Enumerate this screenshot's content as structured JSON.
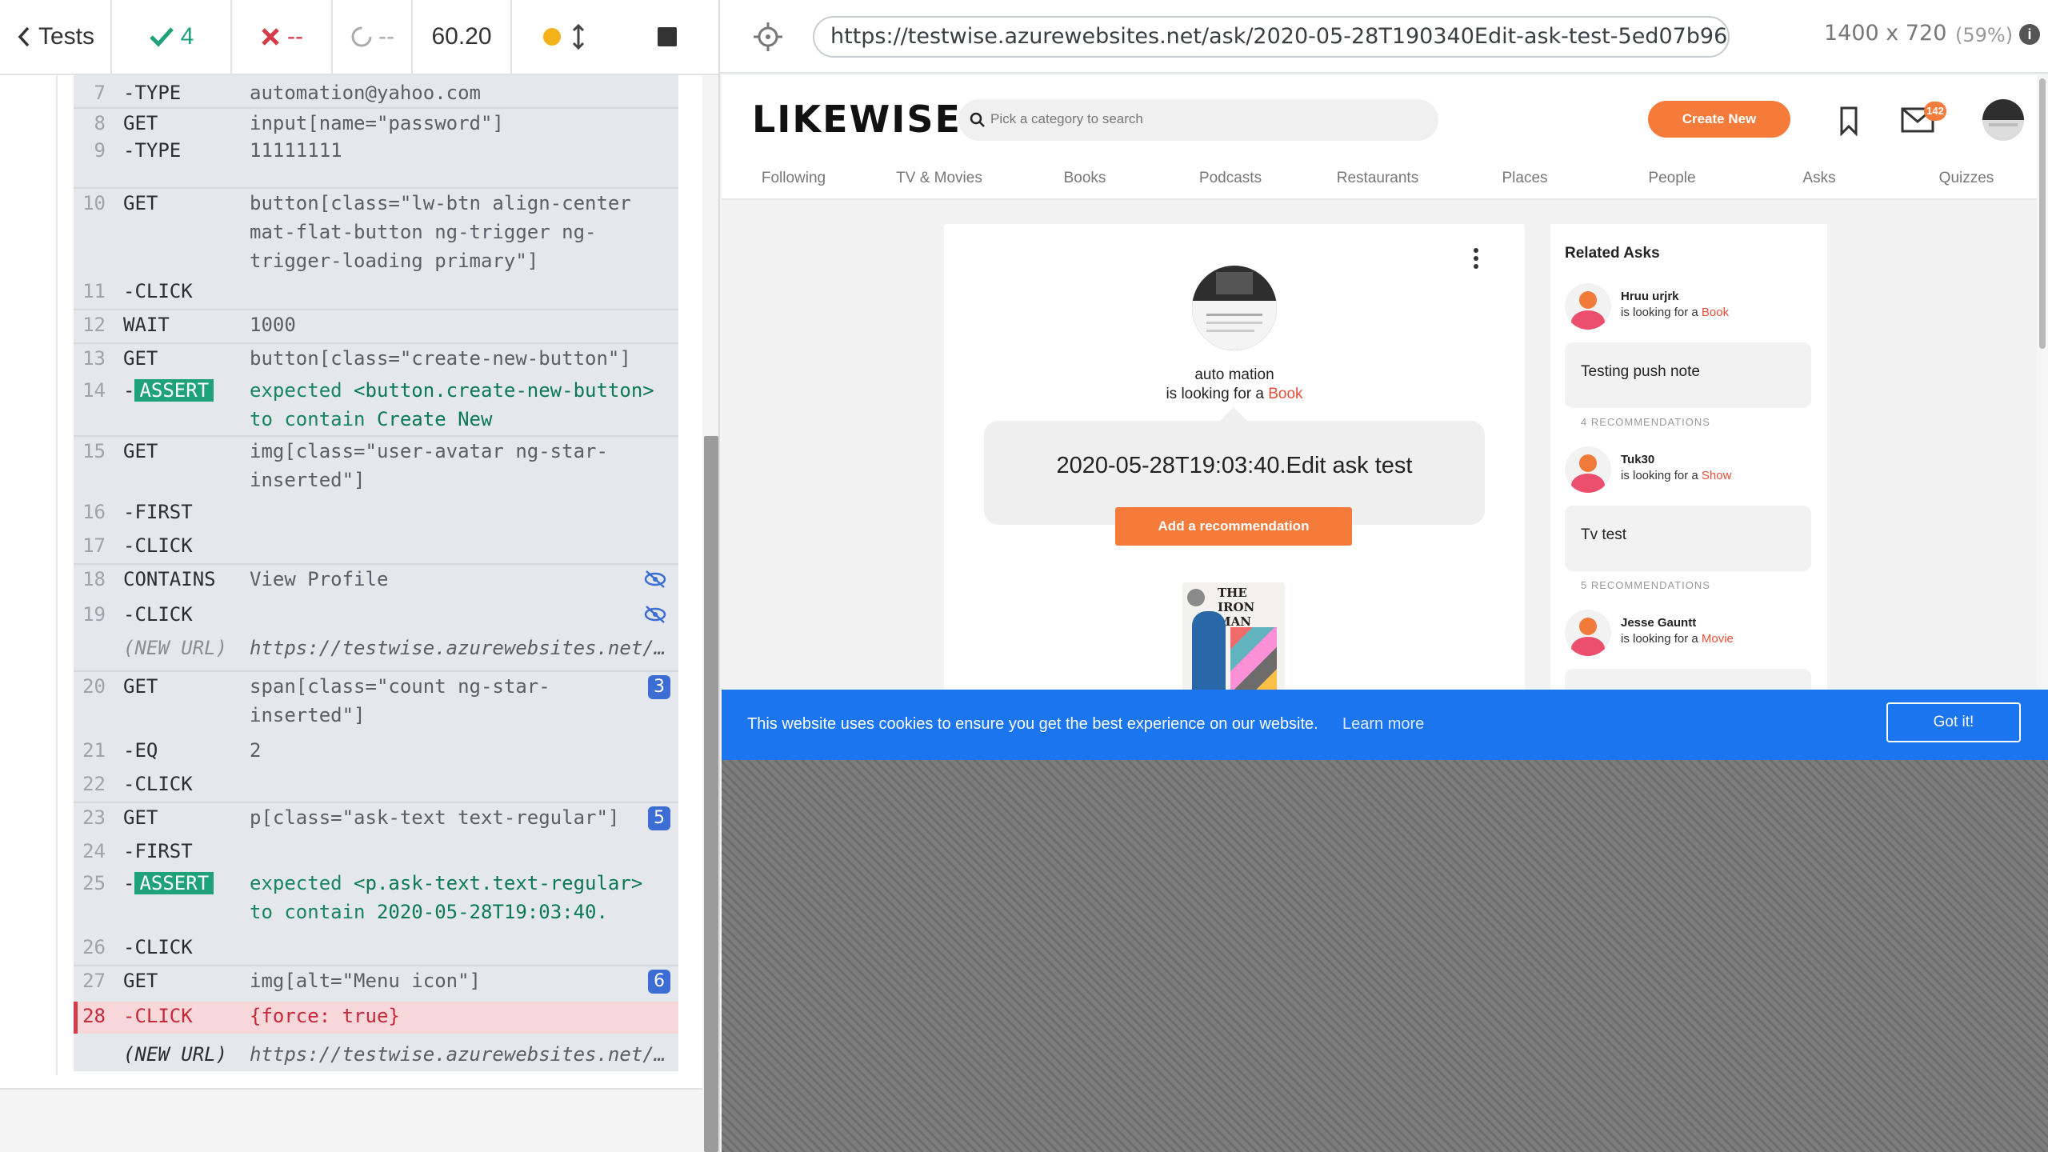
{
  "topbar": {
    "tests_label": "Tests",
    "passed": "4",
    "failed": "--",
    "pending": "--",
    "duration": "60.20"
  },
  "commands": [
    {
      "num": "7",
      "cmd": "-TYPE",
      "msg": "automation@yahoo.com"
    },
    {
      "num": "8",
      "cmd": "GET",
      "msg": "input[name=\"password\"]"
    },
    {
      "num": "9",
      "cmd": "-TYPE",
      "msg": "11111111"
    },
    {
      "num": "10",
      "cmd": "GET",
      "msg": "button[class=\"lw-btn align-center mat-flat-button ng-trigger ng-trigger-loading primary\"]"
    },
    {
      "num": "11",
      "cmd": "-CLICK",
      "msg": ""
    },
    {
      "num": "12",
      "cmd": "WAIT",
      "msg": "1000"
    },
    {
      "num": "13",
      "cmd": "GET",
      "msg": "button[class=\"create-new-button\"]"
    },
    {
      "num": "14",
      "cmd": "-ASSERT",
      "assert_tag": "ASSERT",
      "expected": "expected",
      "subject": "<button.create-new-button>",
      "to_contain": "to contain",
      "value": "Create New"
    },
    {
      "num": "15",
      "cmd": "GET",
      "msg": "img[class=\"user-avatar ng-star-inserted\"]"
    },
    {
      "num": "16",
      "cmd": "-FIRST",
      "msg": ""
    },
    {
      "num": "17",
      "cmd": "-CLICK",
      "msg": ""
    },
    {
      "num": "18",
      "cmd": "CONTAINS",
      "msg": "View Profile"
    },
    {
      "num": "19",
      "cmd": "-CLICK",
      "msg": ""
    },
    {
      "num": "",
      "cmd": "(NEW URL)",
      "msg": "https://testwise.azurewebsites.net/…"
    },
    {
      "num": "20",
      "cmd": "GET",
      "msg": "span[class=\"count ng-star-inserted\"]",
      "badge": "3"
    },
    {
      "num": "21",
      "cmd": "-EQ",
      "msg": "2"
    },
    {
      "num": "22",
      "cmd": "-CLICK",
      "msg": ""
    },
    {
      "num": "23",
      "cmd": "GET",
      "msg": "p[class=\"ask-text text-regular\"]",
      "badge": "5"
    },
    {
      "num": "24",
      "cmd": "-FIRST",
      "msg": ""
    },
    {
      "num": "25",
      "cmd": "-ASSERT",
      "assert_tag": "ASSERT",
      "expected": "expected",
      "subject": "<p.ask-text.text-regular>",
      "to_contain": "to contain",
      "value": "2020-05-28T19:03:40."
    },
    {
      "num": "26",
      "cmd": "-CLICK",
      "msg": ""
    },
    {
      "num": "27",
      "cmd": "GET",
      "msg": "img[alt=\"Menu icon\"]",
      "badge": "6"
    },
    {
      "num": "28",
      "cmd": "-CLICK",
      "msg": "{force: true}"
    },
    {
      "num": "",
      "cmd": "(NEW URL)",
      "msg": "https://testwise.azurewebsites.net/…"
    }
  ],
  "aut": {
    "url": "https://testwise.azurewebsites.net/ask/2020-05-28T190340Edit-ask-test-5ed07b96030144002b2372a9",
    "viewport": "1400 x 720",
    "scale": "(59%)"
  },
  "app": {
    "logo": "LIKEWISE",
    "search_placeholder": "Pick a category to search",
    "create_new": "Create New",
    "mail_count": "142",
    "nav": [
      "Following",
      "TV & Movies",
      "Books",
      "Podcasts",
      "Restaurants",
      "Places",
      "People",
      "Asks",
      "Quizzes"
    ],
    "ask": {
      "user": "auto mation",
      "looking_prefix": "is looking for a",
      "category": "Book",
      "text": "2020-05-28T19:03:40.Edit ask test",
      "rec_button": "Add a recommendation",
      "book_title": "THE IRON MAN"
    },
    "related": {
      "title": "Related Asks",
      "items": [
        {
          "name": "Hruu urjrk",
          "looking": "is looking for a",
          "category": "Book",
          "text": "Testing push note",
          "count": "4 RECOMMENDATIONS"
        },
        {
          "name": "Tuk30",
          "looking": "is looking for a",
          "category": "Show",
          "text": "Tv test",
          "count": "5 RECOMMENDATIONS"
        },
        {
          "name": "Jesse Gauntt",
          "looking": "is looking for a",
          "category": "Movie",
          "text": "",
          "count": ""
        }
      ]
    },
    "cookie": {
      "text": "This website uses cookies to ensure you get the best experience on our website.",
      "learn_more": "Learn more",
      "button": "Got it!"
    }
  },
  "colors": {
    "pass": "#1fa27a",
    "fail": "#d63b48",
    "accent": "#f47b3a",
    "cookie": "#1a75ee",
    "badge": "#3b6dd4"
  }
}
